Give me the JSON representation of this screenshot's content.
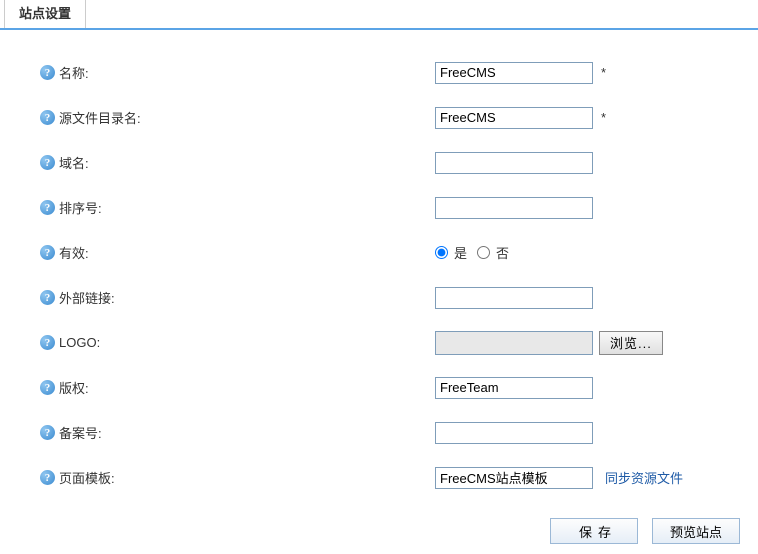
{
  "tab": {
    "title": "站点设置"
  },
  "fields": {
    "name": {
      "label": "名称:",
      "value": "FreeCMS",
      "required": "*"
    },
    "srcdir": {
      "label": "源文件目录名:",
      "value": "FreeCMS",
      "required": "*"
    },
    "domain": {
      "label": "域名:",
      "value": ""
    },
    "sort": {
      "label": "排序号:",
      "value": ""
    },
    "valid": {
      "label": "有效:",
      "yes": "是",
      "no": "否"
    },
    "extlink": {
      "label": "外部链接:",
      "value": ""
    },
    "logo": {
      "label": "LOGO:",
      "browse": "浏览..."
    },
    "copyright": {
      "label": "版权:",
      "value": "FreeTeam"
    },
    "record": {
      "label": "备案号:",
      "value": ""
    },
    "template": {
      "label": "页面模板:",
      "value": "FreeCMS站点模板",
      "sync": "同步资源文件"
    }
  },
  "helpGlyph": "?",
  "buttons": {
    "save": "保存",
    "preview": "预览站点"
  }
}
